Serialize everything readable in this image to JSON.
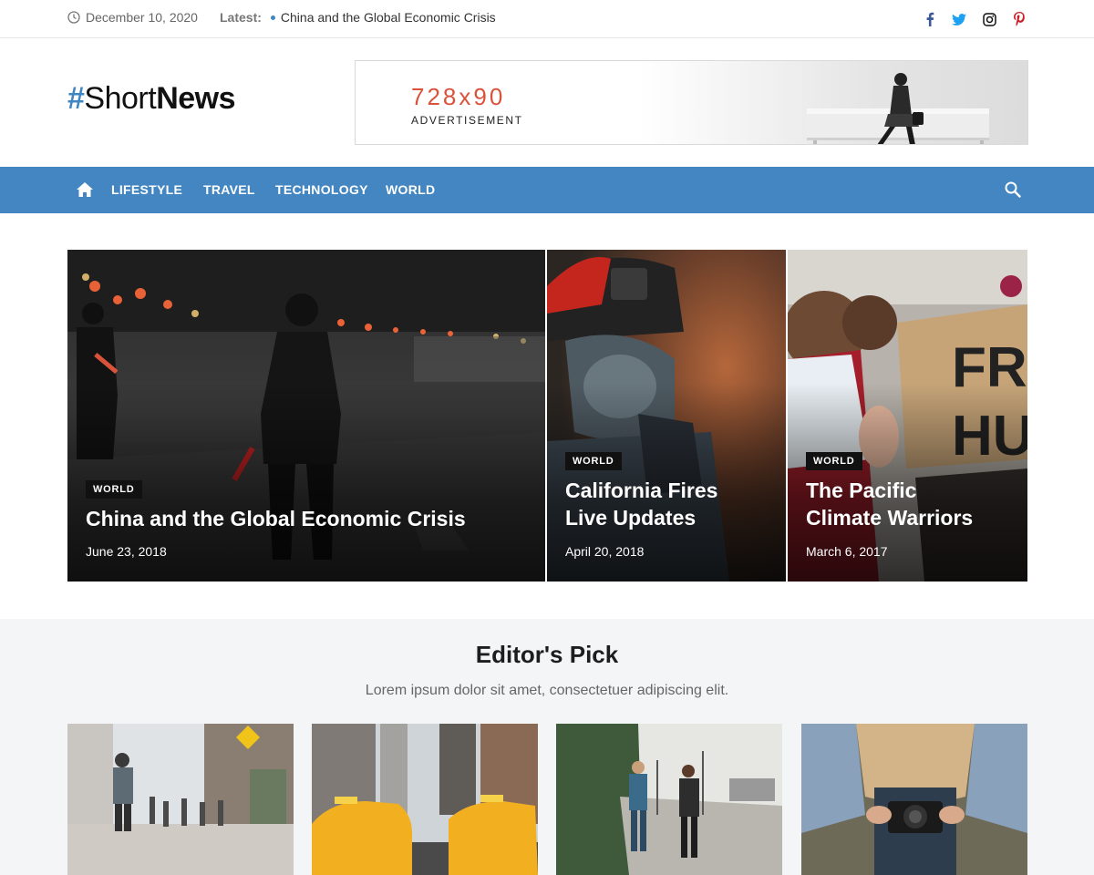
{
  "topbar": {
    "date": "December 10, 2020",
    "latest_label": "Latest:",
    "latest_headline": "China and the Global Economic Crisis",
    "social": [
      {
        "icon": "facebook-icon",
        "color": "#3b5998"
      },
      {
        "icon": "twitter-icon",
        "color": "#1da1f2"
      },
      {
        "icon": "instagram-icon",
        "color": "#111111"
      },
      {
        "icon": "pinterest-icon",
        "color": "#cb2027"
      }
    ]
  },
  "header": {
    "logo_hash": "#",
    "logo_short": "Short",
    "logo_news": "News",
    "ad_size": "728x90",
    "ad_label": "ADVERTISEMENT"
  },
  "nav": {
    "items": [
      "LIFESTYLE",
      "TRAVEL",
      "TECHNOLOGY",
      "WORLD"
    ],
    "accent": "#4386c1"
  },
  "featured": [
    {
      "category": "WORLD",
      "title": "China and the Global Economic Crisis",
      "date": "June 23, 2018"
    },
    {
      "category": "WORLD",
      "title_line1": "California Fires",
      "title_line2": "Live Updates",
      "date": "April 20, 2018"
    },
    {
      "category": "WORLD",
      "title_line1": "The Pacific",
      "title_line2": "Climate Warriors",
      "date": "March 6, 2017"
    }
  ],
  "editors_pick": {
    "heading": "Editor's Pick",
    "subheading": "Lorem ipsum dolor sit amet, consectetuer adipiscing elit."
  }
}
